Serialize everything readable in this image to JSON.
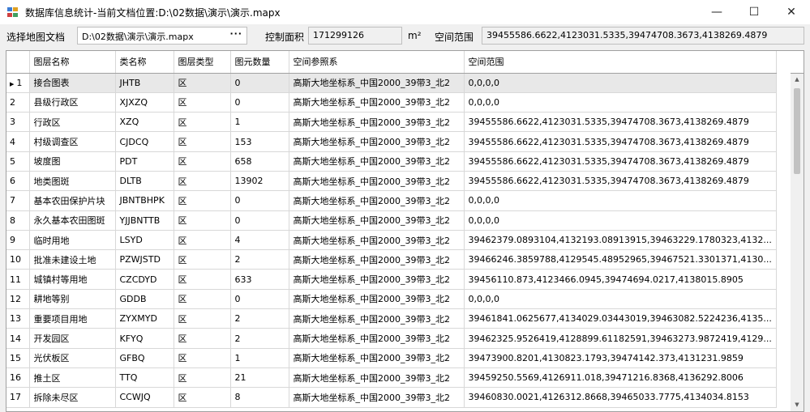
{
  "window": {
    "title": "数据库信息统计-当前文档位置:D:\\02数据\\演示\\演示.mapx",
    "icon": "app-grid-icon",
    "controls": {
      "minimize": "—",
      "maximize": "☐",
      "close": "✕"
    }
  },
  "toolbar": {
    "map_doc_label": "选择地图文档",
    "map_doc_value": "D:\\02数据\\演示\\演示.mapx",
    "browse_label": "···",
    "control_area_label": "控制面积",
    "control_area_value": "171299126",
    "unit": "m²",
    "extent_label": "空间范围",
    "extent_value": "39455586.6622,4123031.5335,39474708.3673,4138269.4879"
  },
  "table": {
    "columns": [
      "图层名称",
      "类名称",
      "图层类型",
      "图元数量",
      "空间参照系",
      "空间范围"
    ],
    "selected_row": 0,
    "rows": [
      {
        "index": "1",
        "name": "接合图表",
        "class": "JHTB",
        "type": "区",
        "count": "0",
        "srs": "高斯大地坐标系_中国2000_39带3_北2",
        "extent": "0,0,0,0"
      },
      {
        "index": "2",
        "name": "县级行政区",
        "class": "XJXZQ",
        "type": "区",
        "count": "0",
        "srs": "高斯大地坐标系_中国2000_39带3_北2",
        "extent": "0,0,0,0"
      },
      {
        "index": "3",
        "name": "行政区",
        "class": "XZQ",
        "type": "区",
        "count": "1",
        "srs": "高斯大地坐标系_中国2000_39带3_北2",
        "extent": "39455586.6622,4123031.5335,39474708.3673,4138269.4879"
      },
      {
        "index": "4",
        "name": "村级调查区",
        "class": "CJDCQ",
        "type": "区",
        "count": "153",
        "srs": "高斯大地坐标系_中国2000_39带3_北2",
        "extent": "39455586.6622,4123031.5335,39474708.3673,4138269.4879"
      },
      {
        "index": "5",
        "name": "坡度图",
        "class": "PDT",
        "type": "区",
        "count": "658",
        "srs": "高斯大地坐标系_中国2000_39带3_北2",
        "extent": "39455586.6622,4123031.5335,39474708.3673,4138269.4879"
      },
      {
        "index": "6",
        "name": "地类图斑",
        "class": "DLTB",
        "type": "区",
        "count": "13902",
        "srs": "高斯大地坐标系_中国2000_39带3_北2",
        "extent": "39455586.6622,4123031.5335,39474708.3673,4138269.4879"
      },
      {
        "index": "7",
        "name": "基本农田保护片块",
        "class": "JBNTBHPK",
        "type": "区",
        "count": "0",
        "srs": "高斯大地坐标系_中国2000_39带3_北2",
        "extent": "0,0,0,0"
      },
      {
        "index": "8",
        "name": "永久基本农田图斑",
        "class": "YJJBNTTB",
        "type": "区",
        "count": "0",
        "srs": "高斯大地坐标系_中国2000_39带3_北2",
        "extent": "0,0,0,0"
      },
      {
        "index": "9",
        "name": "临时用地",
        "class": "LSYD",
        "type": "区",
        "count": "4",
        "srs": "高斯大地坐标系_中国2000_39带3_北2",
        "extent": "39462379.0893104,4132193.08913915,39463229.1780323,4132..."
      },
      {
        "index": "10",
        "name": "批准未建设土地",
        "class": "PZWJSTD",
        "type": "区",
        "count": "2",
        "srs": "高斯大地坐标系_中国2000_39带3_北2",
        "extent": "39466246.3859788,4129545.48952965,39467521.3301371,4130..."
      },
      {
        "index": "11",
        "name": "城镇村等用地",
        "class": "CZCDYD",
        "type": "区",
        "count": "633",
        "srs": "高斯大地坐标系_中国2000_39带3_北2",
        "extent": "39456110.873,4123466.0945,39474694.0217,4138015.8905"
      },
      {
        "index": "12",
        "name": "耕地等别",
        "class": "GDDB",
        "type": "区",
        "count": "0",
        "srs": "高斯大地坐标系_中国2000_39带3_北2",
        "extent": "0,0,0,0"
      },
      {
        "index": "13",
        "name": "重要项目用地",
        "class": "ZYXMYD",
        "type": "区",
        "count": "2",
        "srs": "高斯大地坐标系_中国2000_39带3_北2",
        "extent": "39461841.0625677,4134029.03443019,39463082.5224236,4135..."
      },
      {
        "index": "14",
        "name": "开发园区",
        "class": "KFYQ",
        "type": "区",
        "count": "2",
        "srs": "高斯大地坐标系_中国2000_39带3_北2",
        "extent": "39462325.9526419,4128899.61182591,39463273.9872419,4129..."
      },
      {
        "index": "15",
        "name": "光伏板区",
        "class": "GFBQ",
        "type": "区",
        "count": "1",
        "srs": "高斯大地坐标系_中国2000_39带3_北2",
        "extent": "39473900.8201,4130823.1793,39474142.373,4131231.9859"
      },
      {
        "index": "16",
        "name": "推土区",
        "class": "TTQ",
        "type": "区",
        "count": "21",
        "srs": "高斯大地坐标系_中国2000_39带3_北2",
        "extent": "39459250.5569,4126911.018,39471216.8368,4136292.8006"
      },
      {
        "index": "17",
        "name": "拆除未尽区",
        "class": "CCWJQ",
        "type": "区",
        "count": "8",
        "srs": "高斯大地坐标系_中国2000_39带3_北2",
        "extent": "39460830.0021,4126312.8668,39465033.7775,4134034.8153"
      }
    ]
  },
  "colors": {
    "icon_a": "#3a7bd5",
    "icon_b": "#e0a020",
    "icon_c": "#d04040",
    "icon_d": "#40a060"
  }
}
